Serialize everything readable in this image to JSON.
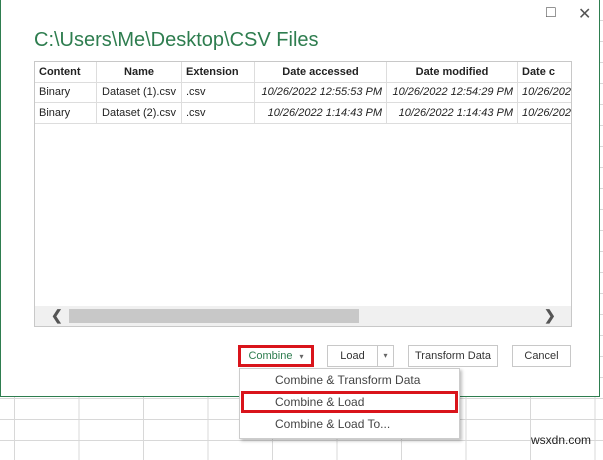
{
  "window": {
    "maximize_icon": "□",
    "close_icon": "✕"
  },
  "title": "C:\\Users\\Me\\Desktop\\CSV Files",
  "table": {
    "columns": [
      "Content",
      "Name",
      "Extension",
      "Date accessed",
      "Date modified",
      "Date c"
    ],
    "rows": [
      [
        "Binary",
        "Dataset (1).csv",
        ".csv",
        "10/26/2022 12:55:53 PM",
        "10/26/2022 12:54:29 PM",
        "10/26/202"
      ],
      [
        "Binary",
        "Dataset (2).csv",
        ".csv",
        "10/26/2022 1:14:43 PM",
        "10/26/2022 1:14:43 PM",
        "10/26/202"
      ]
    ]
  },
  "scroll": {
    "left": "❮",
    "right": "❯"
  },
  "buttons": {
    "combine": "Combine",
    "combine_arrow": "▾",
    "load": "Load",
    "load_arrow": "▾",
    "transform": "Transform Data",
    "cancel": "Cancel"
  },
  "menu": [
    "Combine & Transform Data",
    "Combine & Load",
    "Combine & Load To..."
  ],
  "highlight_color": "#d9141b",
  "accent": "#2e7d4f",
  "watermark": "wsxdn.com"
}
